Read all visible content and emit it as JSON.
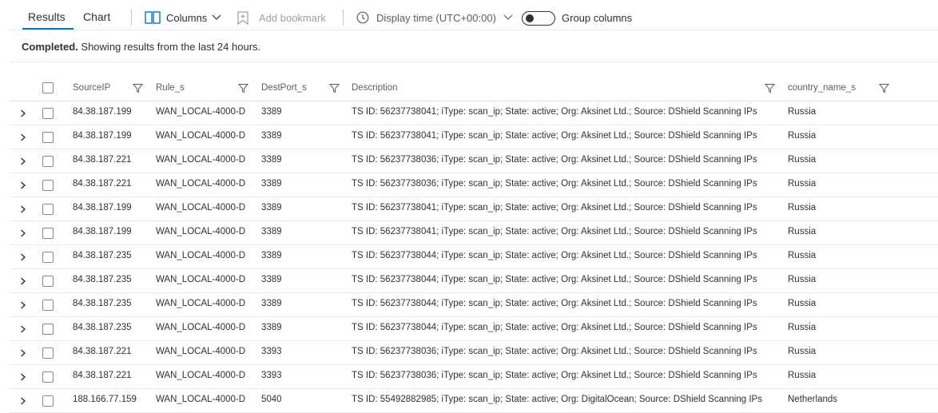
{
  "tabs": {
    "results": "Results",
    "chart": "Chart"
  },
  "toolbar": {
    "columns_label": "Columns",
    "bookmark_label": "Add bookmark",
    "display_time_label": "Display time (UTC+00:00)",
    "group_columns_label": "Group columns"
  },
  "status": {
    "bold": "Completed.",
    "text": " Showing results from the last 24 hours."
  },
  "columns": {
    "source_ip": "SourceIP",
    "rule": "Rule_s",
    "dest_port": "DestPort_s",
    "description": "Description",
    "country": "country_name_s"
  },
  "rows": [
    {
      "ip": "84.38.187.199",
      "rule": "WAN_LOCAL-4000-D",
      "port": "3389",
      "desc": "TS ID: 56237738041; iType: scan_ip; State: active; Org: Aksinet Ltd.; Source: DShield Scanning IPs",
      "country": "Russia"
    },
    {
      "ip": "84.38.187.199",
      "rule": "WAN_LOCAL-4000-D",
      "port": "3389",
      "desc": "TS ID: 56237738041; iType: scan_ip; State: active; Org: Aksinet Ltd.; Source: DShield Scanning IPs",
      "country": "Russia"
    },
    {
      "ip": "84.38.187.221",
      "rule": "WAN_LOCAL-4000-D",
      "port": "3389",
      "desc": "TS ID: 56237738036; iType: scan_ip; State: active; Org: Aksinet Ltd.; Source: DShield Scanning IPs",
      "country": "Russia"
    },
    {
      "ip": "84.38.187.221",
      "rule": "WAN_LOCAL-4000-D",
      "port": "3389",
      "desc": "TS ID: 56237738036; iType: scan_ip; State: active; Org: Aksinet Ltd.; Source: DShield Scanning IPs",
      "country": "Russia"
    },
    {
      "ip": "84.38.187.199",
      "rule": "WAN_LOCAL-4000-D",
      "port": "3389",
      "desc": "TS ID: 56237738041; iType: scan_ip; State: active; Org: Aksinet Ltd.; Source: DShield Scanning IPs",
      "country": "Russia"
    },
    {
      "ip": "84.38.187.199",
      "rule": "WAN_LOCAL-4000-D",
      "port": "3389",
      "desc": "TS ID: 56237738041; iType: scan_ip; State: active; Org: Aksinet Ltd.; Source: DShield Scanning IPs",
      "country": "Russia"
    },
    {
      "ip": "84.38.187.235",
      "rule": "WAN_LOCAL-4000-D",
      "port": "3389",
      "desc": "TS ID: 56237738044; iType: scan_ip; State: active; Org: Aksinet Ltd.; Source: DShield Scanning IPs",
      "country": "Russia"
    },
    {
      "ip": "84.38.187.235",
      "rule": "WAN_LOCAL-4000-D",
      "port": "3389",
      "desc": "TS ID: 56237738044; iType: scan_ip; State: active; Org: Aksinet Ltd.; Source: DShield Scanning IPs",
      "country": "Russia"
    },
    {
      "ip": "84.38.187.235",
      "rule": "WAN_LOCAL-4000-D",
      "port": "3389",
      "desc": "TS ID: 56237738044; iType: scan_ip; State: active; Org: Aksinet Ltd.; Source: DShield Scanning IPs",
      "country": "Russia"
    },
    {
      "ip": "84.38.187.235",
      "rule": "WAN_LOCAL-4000-D",
      "port": "3389",
      "desc": "TS ID: 56237738044; iType: scan_ip; State: active; Org: Aksinet Ltd.; Source: DShield Scanning IPs",
      "country": "Russia"
    },
    {
      "ip": "84.38.187.221",
      "rule": "WAN_LOCAL-4000-D",
      "port": "3393",
      "desc": "TS ID: 56237738036; iType: scan_ip; State: active; Org: Aksinet Ltd.; Source: DShield Scanning IPs",
      "country": "Russia"
    },
    {
      "ip": "84.38.187.221",
      "rule": "WAN_LOCAL-4000-D",
      "port": "3393",
      "desc": "TS ID: 56237738036; iType: scan_ip; State: active; Org: Aksinet Ltd.; Source: DShield Scanning IPs",
      "country": "Russia"
    },
    {
      "ip": "188.166.77.159",
      "rule": "WAN_LOCAL-4000-D",
      "port": "5040",
      "desc": "TS ID: 55492882985; iType: scan_ip; State: active; Org: DigitalOcean; Source: DShield Scanning IPs",
      "country": "Netherlands"
    }
  ],
  "icons": {
    "columns": "columns-icon",
    "bookmark": "bookmark-icon",
    "clock": "clock-icon",
    "chevron": "chevron-down-icon",
    "filter": "filter-icon",
    "expand": "chevron-right-icon"
  },
  "colors": {
    "accent": "#0078d4",
    "disabled": "#a19f9d"
  }
}
